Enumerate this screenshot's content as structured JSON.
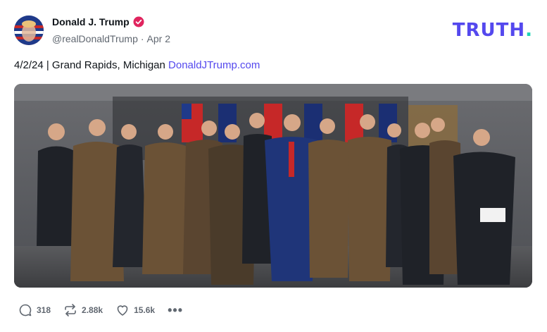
{
  "author": {
    "display_name": "Donald J. Trump",
    "handle": "@realDonaldTrump",
    "separator": "·",
    "date": "Apr 2",
    "verified_icon": "verified-badge-icon"
  },
  "brand": {
    "logo_main": "TRUTH",
    "logo_dot": ".",
    "colors": {
      "primary": "#5448ee",
      "accent": "#1ed5b4"
    }
  },
  "post": {
    "text": "4/2/24 | Grand Rapids, Michigan ",
    "link": "DonaldJTrump.com"
  },
  "actions": {
    "replies": "318",
    "retruths": "2.88k",
    "likes": "15.6k",
    "more": "•••"
  }
}
